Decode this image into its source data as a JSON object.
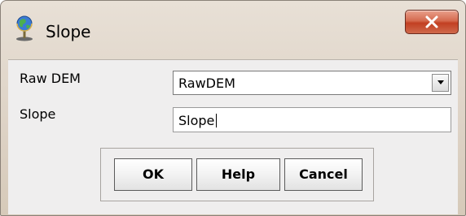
{
  "window": {
    "title": "Slope",
    "icon": "globe-icon"
  },
  "titlebar": {
    "close_icon": "close-icon",
    "close_color": "#c74a2e"
  },
  "form": {
    "raw_dem_label": "Raw DEM",
    "raw_dem_value": "RawDEM",
    "slope_label": "Slope",
    "slope_value": "Slope"
  },
  "buttons": {
    "ok": "OK",
    "help": "Help",
    "cancel": "Cancel"
  }
}
